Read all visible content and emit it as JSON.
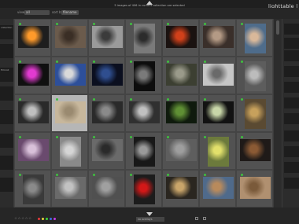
{
  "header": {
    "collection_count": "5 images of 406 in current collection are selected",
    "view_title": "lighttable | da",
    "view_label": "view",
    "view_value": "all",
    "sort_label": "sort by",
    "sort_value": "filename"
  },
  "left_panel": {
    "texts": [
      "collection",
      "",
      "filmroll",
      "",
      "",
      "",
      "",
      ""
    ]
  },
  "right_panel": {
    "texts": [
      "",
      "",
      "",
      "",
      "",
      "",
      "",
      "",
      "",
      "",
      ""
    ]
  },
  "grid": {
    "cells": [
      {
        "color": "#1e1e1e",
        "accent": "#ff9a2a",
        "tall": false,
        "light": false
      },
      {
        "color": "#6b5b4c",
        "accent": "#3a2e25",
        "tall": false,
        "light": false
      },
      {
        "color": "#9a9a9a",
        "accent": "#3b3b3b",
        "tall": false,
        "light": false
      },
      {
        "color": "#7a7a7a",
        "accent": "#2c2c2c",
        "tall": true,
        "light": false
      },
      {
        "color": "#1a1210",
        "accent": "#d1401a",
        "tall": false,
        "light": false
      },
      {
        "color": "#3a2f2a",
        "accent": "#b49a85",
        "tall": false,
        "light": false
      },
      {
        "color": "#4e6c8b",
        "accent": "#d9b89a",
        "tall": true,
        "light": false
      },
      {
        "color": "#101010",
        "accent": "#e23ad1",
        "tall": false,
        "light": false
      },
      {
        "color": "#2d4f9a",
        "accent": "#d9d9d9",
        "tall": false,
        "light": false
      },
      {
        "color": "#0b0f1f",
        "accent": "#2f4e8f",
        "tall": false,
        "light": false
      },
      {
        "color": "#0d0d0d",
        "accent": "#7a7a7a",
        "tall": true,
        "light": false
      },
      {
        "color": "#3c3f32",
        "accent": "#9a9a8a",
        "tall": false,
        "light": false
      },
      {
        "color": "#c6c6c6",
        "accent": "#6a6a6a",
        "tall": false,
        "light": false
      },
      {
        "color": "#5d5d5d",
        "accent": "#bcbcbc",
        "tall": true,
        "light": false
      },
      {
        "color": "#2a2a2a",
        "accent": "#bfbfbf",
        "tall": false,
        "light": false
      },
      {
        "color": "#c7b79c",
        "accent": "#9a8a70",
        "tall": false,
        "light": true
      },
      {
        "color": "#2a2a2a",
        "accent": "#8a8a8a",
        "tall": false,
        "light": false
      },
      {
        "color": "#303030",
        "accent": "#c0c0c0",
        "tall": false,
        "light": false
      },
      {
        "color": "#0f1a0d",
        "accent": "#5f8f34",
        "tall": false,
        "light": false
      },
      {
        "color": "#121212",
        "accent": "#c8d6a8",
        "tall": false,
        "light": false
      },
      {
        "color": "#5a4a32",
        "accent": "#c7a15c",
        "tall": true,
        "light": false
      },
      {
        "color": "#6a4a6e",
        "accent": "#d8c0d9",
        "tall": false,
        "light": false
      },
      {
        "color": "#8a8a8a",
        "accent": "#d5d5d5",
        "tall": true,
        "light": false
      },
      {
        "color": "#6a6a6a",
        "accent": "#2a2a2a",
        "tall": false,
        "light": false
      },
      {
        "color": "#181818",
        "accent": "#9a9a9a",
        "tall": true,
        "light": false
      },
      {
        "color": "#5e5e5e",
        "accent": "#9e9e9e",
        "tall": false,
        "light": false
      },
      {
        "color": "#6c7a3c",
        "accent": "#e2e06b",
        "tall": true,
        "light": false
      },
      {
        "color": "#1f1a18",
        "accent": "#8b5a34",
        "tall": false,
        "light": false
      },
      {
        "color": "#3a3a3a",
        "accent": "#8a8a8a",
        "tall": true,
        "light": false
      },
      {
        "color": "#6a6a6a",
        "accent": "#c2c2c2",
        "tall": false,
        "light": false
      },
      {
        "color": "#505050",
        "accent": "#a0a0a0",
        "tall": false,
        "light": false
      },
      {
        "color": "#1c1c1c",
        "accent": "#d21818",
        "tall": true,
        "light": false
      },
      {
        "color": "#2a2620",
        "accent": "#c9a56a",
        "tall": false,
        "light": false
      },
      {
        "color": "#4f6a8b",
        "accent": "#b88a5c",
        "tall": false,
        "light": false
      },
      {
        "color": "#b09070",
        "accent": "#7a5a3a",
        "tall": false,
        "light": false
      }
    ]
  },
  "footer": {
    "stars": "☆☆☆☆☆",
    "colors": [
      "#e63b3b",
      "#e6d63b",
      "#3bd63b",
      "#3b6be6",
      "#c93be6"
    ],
    "select_value": "no overlays"
  }
}
